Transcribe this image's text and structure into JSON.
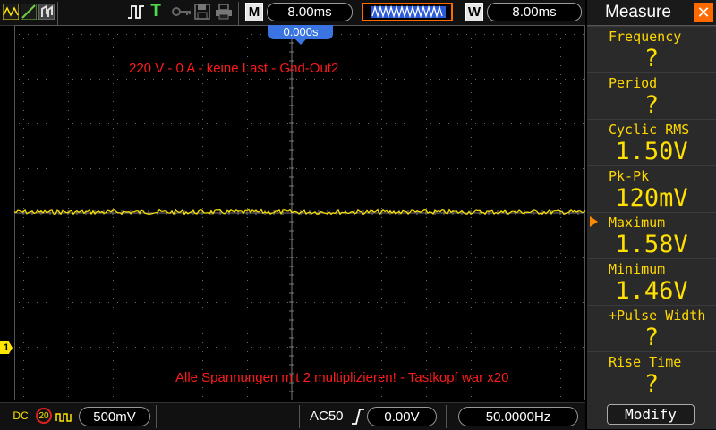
{
  "toolbar": {
    "trigger_status": "T",
    "timebase_main_label": "M",
    "timebase_main_value": "8.00ms",
    "window_label": "W",
    "window_value": "8.00ms"
  },
  "screen": {
    "trigger_position": "0.000s",
    "annotation_top": "220 V - 0 A - keine Last - Gnd-Out2",
    "annotation_bottom": "Alle Spannungen mit 2 multiplizieren! - Tastkopf war x20",
    "channel_marker": "1",
    "trace_color": "#ffe600"
  },
  "statusbar": {
    "coupling": "DC",
    "bandwidth_limit": "20",
    "volts_per_div": "500mV",
    "trigger_mode": "AC50",
    "trigger_level": "0.00V",
    "frequency": "50.0000Hz"
  },
  "measure": {
    "title": "Measure",
    "items": [
      {
        "label": "Frequency",
        "value": "?"
      },
      {
        "label": "Period",
        "value": "?"
      },
      {
        "label": "Cyclic RMS",
        "value": "1.50V"
      },
      {
        "label": "Pk-Pk",
        "value": "120mV"
      },
      {
        "label": "Maximum",
        "value": "1.58V"
      },
      {
        "label": "Minimum",
        "value": "1.46V"
      },
      {
        "label": "+Pulse Width",
        "value": "?"
      },
      {
        "label": "Rise Time",
        "value": "?"
      }
    ],
    "selected_index": 4,
    "modify_label": "Modify"
  },
  "colors": {
    "accent": "#ff6a00",
    "measure_text": "#ffd800",
    "annotation": "#ff1a1a",
    "trigger_marker": "#3a74e0"
  }
}
